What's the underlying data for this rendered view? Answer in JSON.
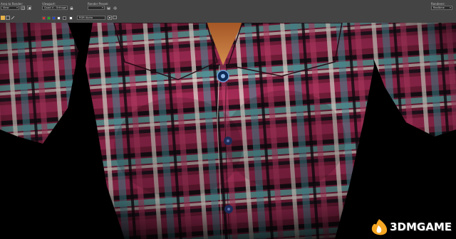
{
  "toolbar": {
    "area_to_render": {
      "label": "Area to Render:",
      "value": "View"
    },
    "viewport": {
      "label": "Viewport:",
      "value": "Quad 4 - Orthogr"
    },
    "render_preset": {
      "label": "Render Preset:",
      "value": ""
    },
    "renderer": {
      "label": "Renderer:",
      "value": "Realtime"
    },
    "channel": {
      "value": "RGB Alpha"
    }
  },
  "watermark": {
    "text": "3DMGAME"
  },
  "icons": [
    "lock-icon",
    "save-icon",
    "gear-icon",
    "color-swatch-icon",
    "display-icon"
  ],
  "colors": {
    "toolbar_bg": "#444444",
    "viewport_bg": "#000000",
    "watermark_orange": "#f5a623"
  }
}
